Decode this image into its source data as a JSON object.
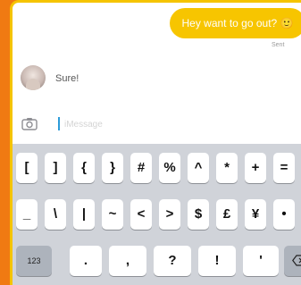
{
  "chat": {
    "sent_message": "Hey want to go out? 🙂",
    "sent_status": "Sent",
    "reply_text": "Sure!"
  },
  "input": {
    "placeholder": "iMessage",
    "value": ""
  },
  "keyboard": {
    "row1": [
      "[",
      "]",
      "{",
      "}",
      "#",
      "%",
      "^",
      "*",
      "+",
      "="
    ],
    "row2": [
      "_",
      "\\",
      "|",
      "~",
      "<",
      ">",
      "$",
      "£",
      "¥",
      "•"
    ],
    "row3": [
      ".",
      ",",
      "?",
      "!",
      "'"
    ],
    "mode_key": "123"
  },
  "icons": {
    "camera": "camera-icon",
    "delete": "backspace-icon"
  },
  "colors": {
    "accent_yellow": "#f7c500",
    "frame_orange": "#f07a12",
    "keyboard_bg": "#d0d3d9"
  }
}
